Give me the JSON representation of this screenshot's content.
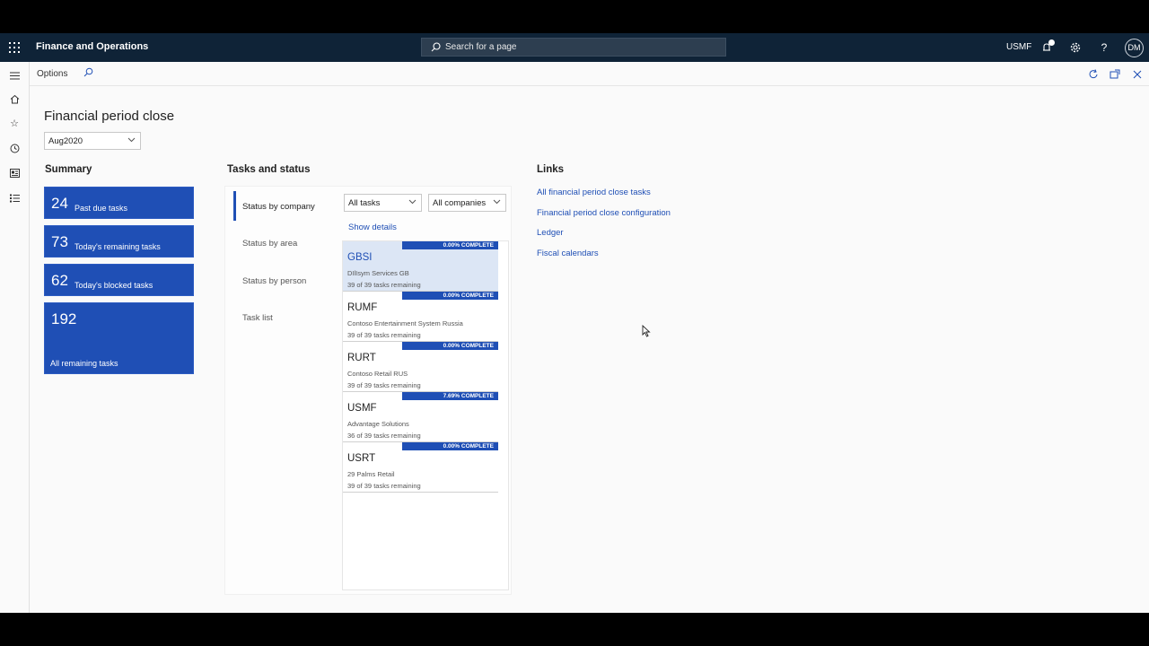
{
  "topbar": {
    "app_title": "Finance and Operations",
    "search_placeholder": "Search for a page",
    "company": "USMF",
    "avatar_initials": "DM"
  },
  "actionbar": {
    "options_label": "Options"
  },
  "page": {
    "title": "Financial period close",
    "period": "Aug2020"
  },
  "summary": {
    "heading": "Summary",
    "tiles": [
      {
        "count": "24",
        "label": "Past due tasks"
      },
      {
        "count": "73",
        "label": "Today's remaining tasks"
      },
      {
        "count": "62",
        "label": "Today's blocked tasks"
      },
      {
        "count": "192",
        "label": "All remaining tasks"
      }
    ]
  },
  "tasks": {
    "heading": "Tasks and status",
    "tabs": [
      "Status by company",
      "Status by area",
      "Status by person",
      "Task list"
    ],
    "filter_tasks": "All tasks",
    "filter_companies": "All companies",
    "show_details": "Show details",
    "companies": [
      {
        "code": "GBSI",
        "name": "DIlIsym Services GB",
        "remaining": "39 of 39 tasks remaining",
        "complete": "0.00% COMPLETE",
        "complete_pct": 0.0
      },
      {
        "code": "RUMF",
        "name": "Contoso Entertainment System Russia",
        "remaining": "39 of 39 tasks remaining",
        "complete": "0.00% COMPLETE",
        "complete_pct": 0.0
      },
      {
        "code": "RURT",
        "name": "Contoso Retail RUS",
        "remaining": "39 of 39 tasks remaining",
        "complete": "0.00% COMPLETE",
        "complete_pct": 0.0
      },
      {
        "code": "USMF",
        "name": "Advantage Solutions",
        "remaining": "36 of 39 tasks remaining",
        "complete": "7.69% COMPLETE",
        "complete_pct": 7.69
      },
      {
        "code": "USRT",
        "name": "29 Palms Retail",
        "remaining": "39 of 39 tasks remaining",
        "complete": "0.00% COMPLETE",
        "complete_pct": 0.0
      }
    ]
  },
  "links": {
    "heading": "Links",
    "items": [
      "All financial period close tasks",
      "Financial period close configuration",
      "Ledger",
      "Fiscal calendars"
    ]
  },
  "colors": {
    "nav": "#0f2337",
    "accent": "#1f4fb5",
    "selected": "#dce6f5"
  }
}
